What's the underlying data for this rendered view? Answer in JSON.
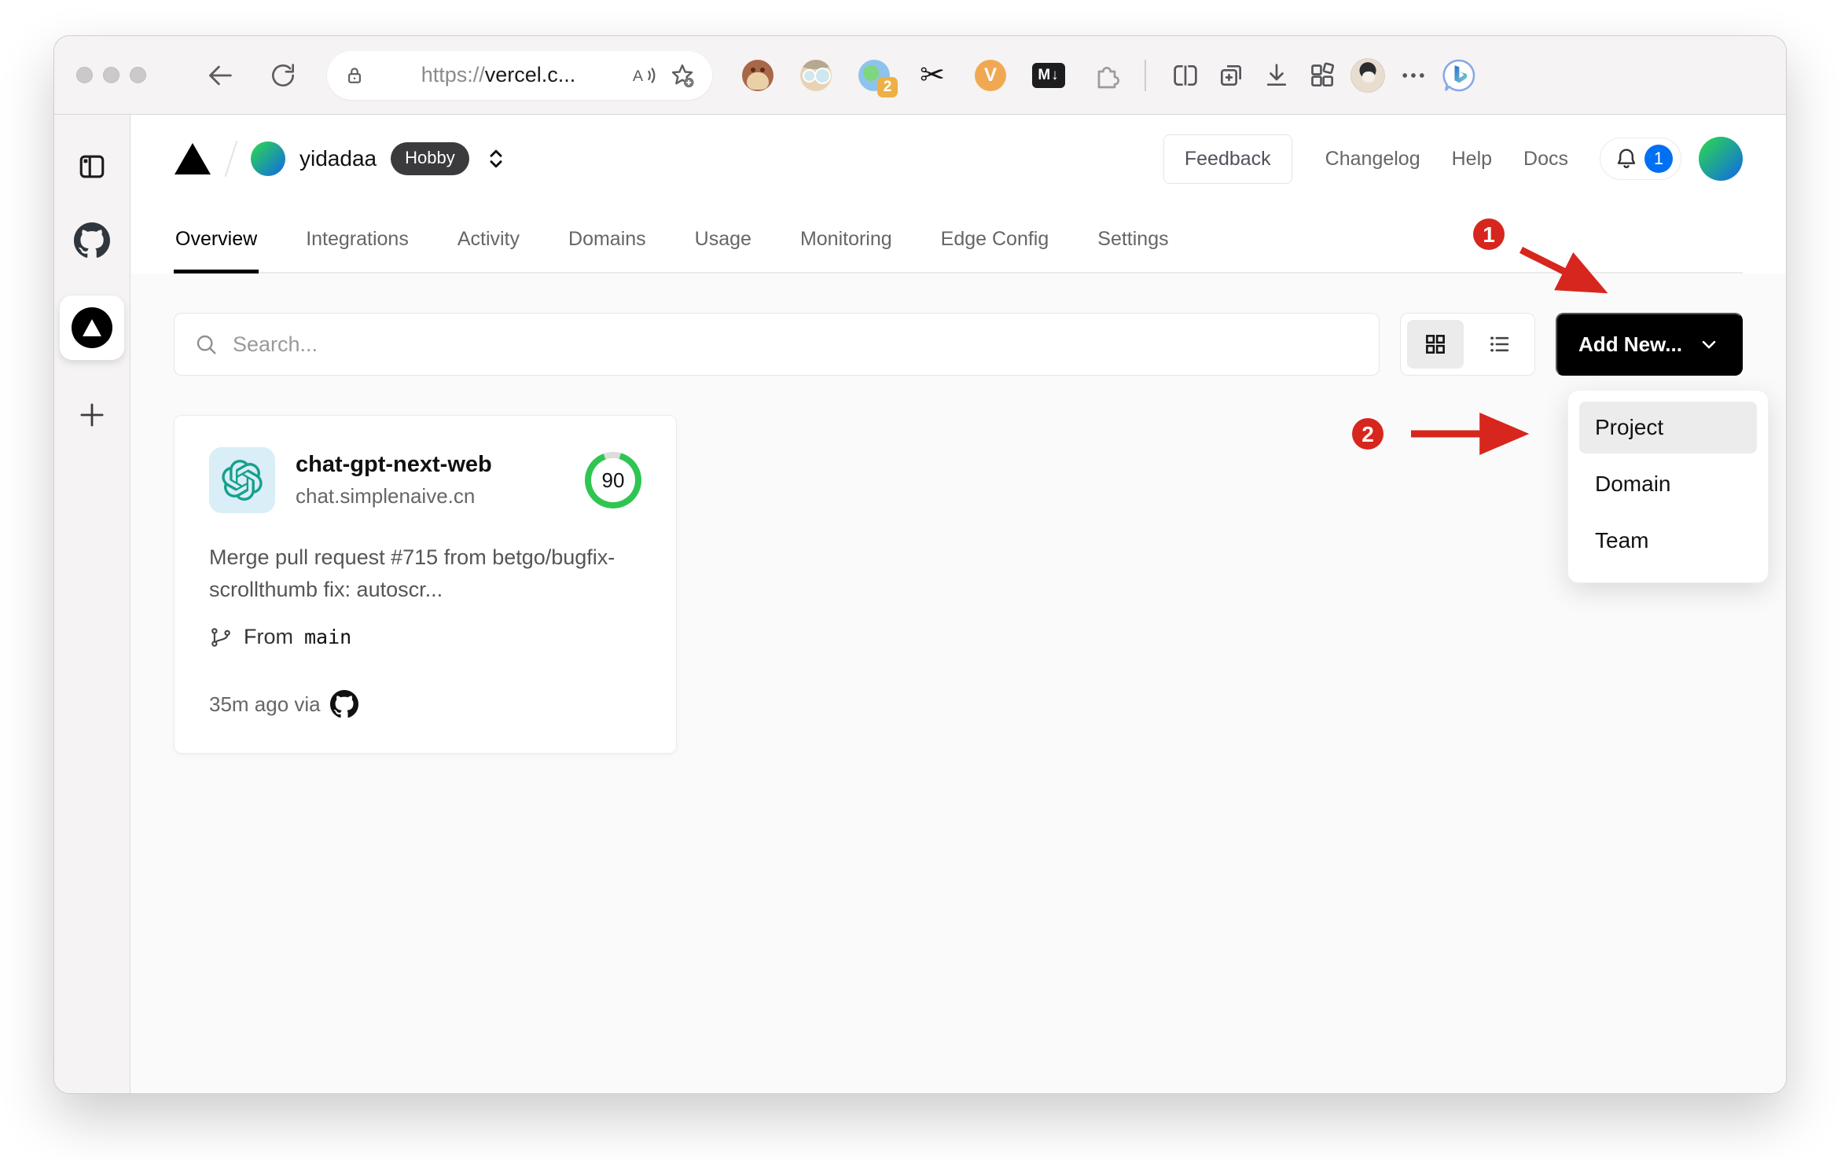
{
  "browser": {
    "url": {
      "scheme": "https://",
      "host": "vercel.c..."
    },
    "extensions": {
      "translate_badge": "2",
      "v_label": "V",
      "markdown_label": "M↓",
      "scissors_glyph": "✂"
    }
  },
  "site": {
    "team_name": "yidadaa",
    "plan_badge": "Hobby",
    "nav": {
      "feedback": "Feedback",
      "changelog": "Changelog",
      "help": "Help",
      "docs": "Docs",
      "notification_count": "1"
    },
    "tabs": [
      {
        "label": "Overview"
      },
      {
        "label": "Integrations"
      },
      {
        "label": "Activity"
      },
      {
        "label": "Domains"
      },
      {
        "label": "Usage"
      },
      {
        "label": "Monitoring"
      },
      {
        "label": "Edge Config"
      },
      {
        "label": "Settings"
      }
    ],
    "toolbar": {
      "search_placeholder": "Search...",
      "add_new_label": "Add New..."
    },
    "dropdown": {
      "items": [
        "Project",
        "Domain",
        "Team"
      ]
    },
    "project_card": {
      "name": "chat-gpt-next-web",
      "domain": "chat.simplenaive.cn",
      "score": "90",
      "commit_message": "Merge pull request #715 from betgo/bugfix-scrollthumb fix: autoscr...",
      "branch_label": "From",
      "branch_name": "main",
      "meta": "35m ago via"
    }
  },
  "annotations": {
    "step1": "1",
    "step2": "2"
  },
  "colors": {
    "annotation_red": "#d7261d",
    "accent_blue": "#0070f3",
    "score_green": "#2fc553",
    "button_black": "#000000"
  }
}
